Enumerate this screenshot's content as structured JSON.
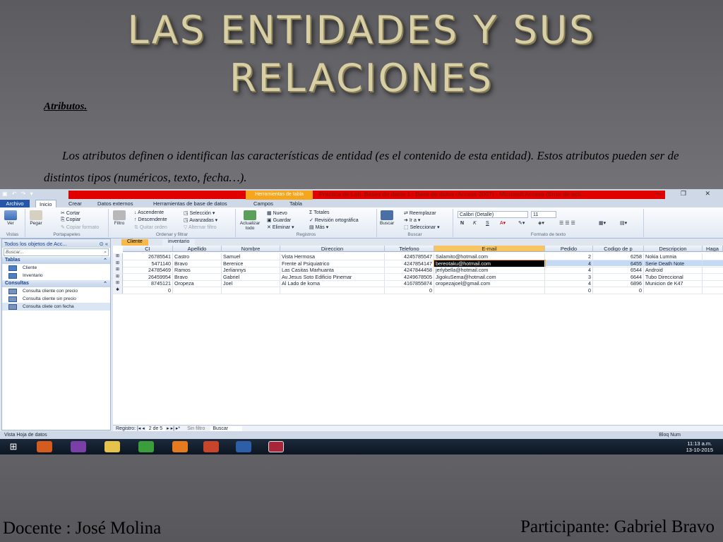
{
  "slide": {
    "title_line1": "LAS ENTIDADES Y SUS",
    "title_line2": "RELACIONES",
    "subheading": "Atributos.",
    "paragraph": "Los atributos definen o identifican las características de entidad (es el contenido de esta entidad). Estos atributos pueden ser de distintos tipos (numéricos, texto, fecha…).",
    "footer_left": "Docente : José Molina",
    "footer_right": "Participante: Gabriel Bravo"
  },
  "access": {
    "title": "Practica de Lab. Bases de datos 1 : Base de datos (Access 2007) - Microsoft Access (Error de acti...",
    "context_tab": "Herramientas de tabla",
    "tabs": [
      "Archivo",
      "Inicio",
      "Crear",
      "Datos externos",
      "Herramientas de base de datos",
      "Campos",
      "Tabla"
    ],
    "ribbon": {
      "vistas": {
        "ver": "Ver",
        "label": "Vistas"
      },
      "portapapeles": {
        "pegar": "Pegar",
        "cortar": "Cortar",
        "copiar": "Copiar",
        "copiar_formato": "Copiar formato",
        "label": "Portapapeles"
      },
      "ordenar": {
        "filtro": "Filtro",
        "ascendente": "Ascendente",
        "descendente": "Descendente",
        "quitar_orden": "Quitar orden",
        "seleccion": "Selección",
        "avanzadas": "Avanzadas",
        "alternar_filtro": "Alternar filtro",
        "label": "Ordenar y filtrar"
      },
      "registros": {
        "actualizar": "Actualizar todo",
        "nuevo": "Nuevo",
        "guardar": "Guardar",
        "eliminar": "Eliminar",
        "totales": "Totales",
        "revision": "Revisión ortográfica",
        "mas": "Más",
        "label": "Registros"
      },
      "buscar": {
        "buscar": "Buscar",
        "reemplazar": "Reemplazar",
        "ir_a": "Ir a",
        "seleccionar": "Seleccionar",
        "label": "Buscar"
      },
      "formato": {
        "font": "Calibri (Detalle)",
        "size": "11",
        "bold": "N",
        "italic": "K",
        "underline": "S",
        "label": "Formato de texto"
      }
    },
    "nav": {
      "header": "Todos los objetos de Acc...",
      "search_placeholder": "Buscar...",
      "sections": [
        {
          "title": "Tablas",
          "items": [
            "Cliente",
            "Inventario"
          ]
        },
        {
          "title": "Consultas",
          "items": [
            "Consulta cliente con precio",
            "Consulta cliente sin precio",
            "Consulta cliete con fecha"
          ]
        }
      ]
    },
    "doc_tabs": [
      "Cliente",
      "inventario"
    ],
    "table": {
      "columns": [
        "CI",
        "Apellido",
        "Nombre",
        "Direccion",
        "Telefono",
        "E-mail",
        "Pedido",
        "Codigo de p",
        "Descripcion",
        "Haga"
      ],
      "rows": [
        [
          "26785541",
          "Castro",
          "Samuel",
          "Vista Hermosa",
          "4245785547",
          "Salamito@hotmail.com",
          "2",
          "6258",
          "Nokia Lumnia"
        ],
        [
          "5471140",
          "Bravo",
          "Berenice",
          "Frente al Psiquiatrico",
          "4247854147",
          "bereotaku@hotmail.com",
          "4",
          "6455",
          "Serie Death Note"
        ],
        [
          "24785469",
          "Ramos",
          "Jerliannys",
          "Las Casitas Marhuanta",
          "4247844458",
          "jerlybella@hotmail.com",
          "4",
          "6544",
          "Android"
        ],
        [
          "26459954",
          "Bravo",
          "Gabriel",
          "Av.Jesus Soto Edificio Pinemar",
          "4249678505",
          "JigokuSema@hotmail.com",
          "3",
          "6644",
          "Tubo Direccional"
        ],
        [
          "8745121",
          "Oropeza",
          "Joel",
          "Al Lado de koma",
          "4167855874",
          "oropezajoel@gmail.com",
          "4",
          "6896",
          "Municion de K47"
        ],
        [
          "0",
          "",
          "",
          "",
          "0",
          "",
          "0",
          "0",
          ""
        ]
      ]
    },
    "record_nav": {
      "label": "Registro:",
      "position": "2 de 5",
      "filter": "Sin filtro",
      "search": "Buscar"
    },
    "status_left": "Vista Hoja de datos",
    "status_right": "Bloq Num"
  },
  "taskbar": {
    "time": "11:13 a.m.",
    "date": "13-10-2015"
  }
}
